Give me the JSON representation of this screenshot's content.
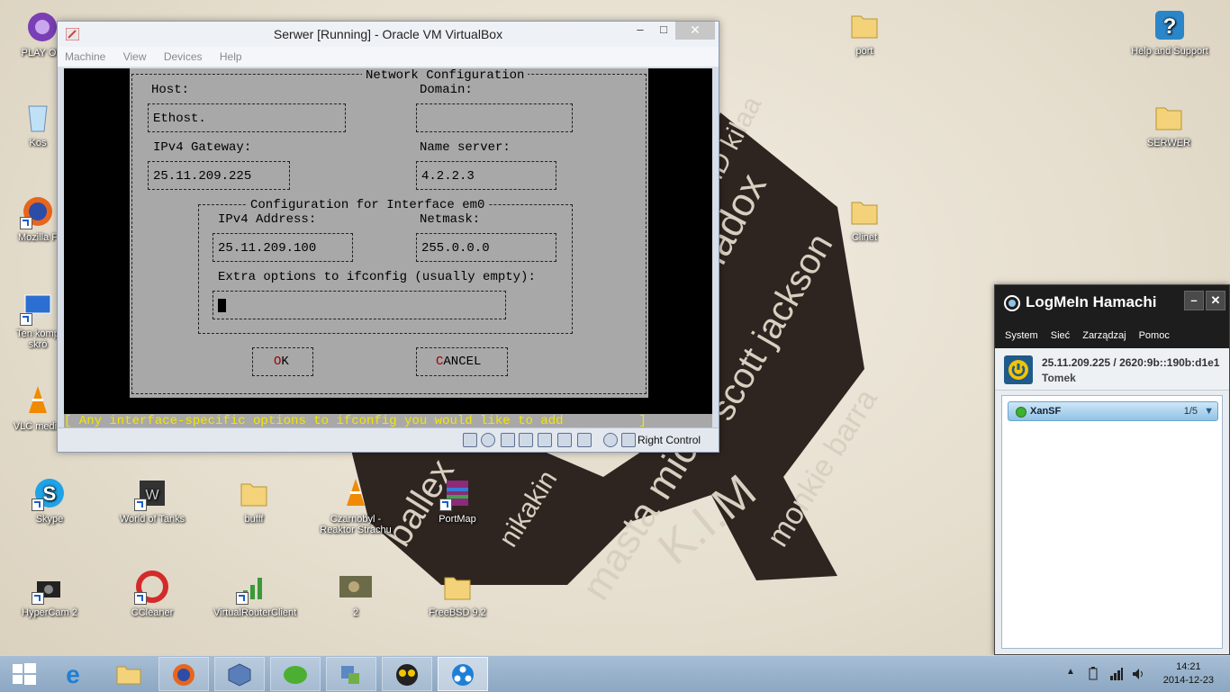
{
  "desktop": {
    "icons": [
      {
        "label": "PLAY ON"
      },
      {
        "label": "Kos"
      },
      {
        "label": "Mozilla F"
      },
      {
        "label": "Ten komp skró"
      },
      {
        "label": "VLC media"
      },
      {
        "label": "Skype"
      },
      {
        "label": "World of Tanks"
      },
      {
        "label": "bufff"
      },
      {
        "label": "Czarnobyl - Reaktor Strachu"
      },
      {
        "label": "PortMap"
      },
      {
        "label": "HyperCam 2"
      },
      {
        "label": "CCleaner"
      },
      {
        "label": "VirtualRouterClient"
      },
      {
        "label": "2"
      },
      {
        "label": "FreeBSD 9.2"
      },
      {
        "label": "port"
      },
      {
        "label": "Clinet"
      },
      {
        "label": "Help and Support"
      },
      {
        "label": "SERWER"
      }
    ]
  },
  "vbox": {
    "title": "Serwer [Running] - Oracle VM VirtualBox",
    "menu": [
      "Machine",
      "View",
      "Devices",
      "Help"
    ],
    "controls": {
      "minimize": "–",
      "maximize": "□",
      "close": "✕"
    },
    "host_key": "Right Control"
  },
  "netconfig": {
    "title": "Network Configuration",
    "host_label": "Host:",
    "host_value": "Ethost.",
    "domain_label": "Domain:",
    "domain_value": "",
    "gateway_label": "IPv4 Gateway:",
    "gateway_value": "25.11.209.225",
    "nameserver_label": "Name server:",
    "nameserver_value": "4.2.2.3",
    "iface_title": "Configuration for Interface em0",
    "ipv4_label": "IPv4 Address:",
    "ipv4_value": "25.11.209.100",
    "netmask_label": "Netmask:",
    "netmask_value": "255.0.0.0",
    "extra_label": "Extra options to ifconfig (usually empty):",
    "extra_value": "",
    "ok_hot": "O",
    "ok_rest": "K",
    "cancel_hot": "C",
    "cancel_rest": "ANCEL",
    "status": "[ Any interface-specific options to ifconfig you would like to add          ]"
  },
  "hamachi": {
    "title": "LogMeIn Hamachi",
    "menu": [
      "System",
      "Sieć",
      "Zarządzaj",
      "Pomoc"
    ],
    "address": "25.11.209.225 / 2620:9b::190b:d1e1",
    "nickname": "Tomek",
    "networks": [
      {
        "name": "XanSF",
        "members": "1/5"
      }
    ],
    "controls": {
      "minimize": "–",
      "close": "✕"
    }
  },
  "taskbar": {
    "time": "14:21",
    "date": "2014-12-23"
  }
}
